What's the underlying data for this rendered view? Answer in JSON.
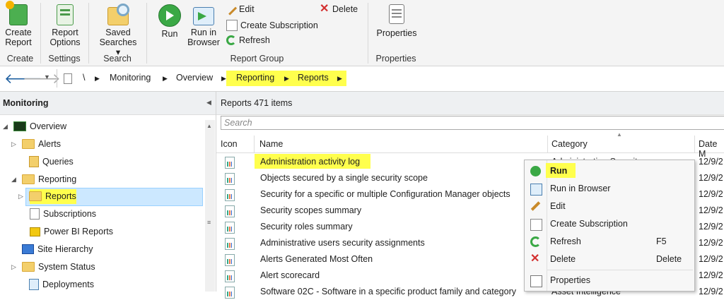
{
  "ribbon": {
    "create_report": "Create\nReport",
    "report_options": "Report\nOptions",
    "saved_searches": "Saved\nSearches ▾",
    "run": "Run",
    "run_in_browser": "Run in\nBrowser",
    "edit": "Edit",
    "create_subscription": "Create Subscription",
    "refresh": "Refresh",
    "delete": "Delete",
    "properties": "Properties",
    "groups": {
      "create": "Create",
      "settings": "Settings",
      "search": "Search",
      "report_group": "Report Group",
      "properties": "Properties"
    }
  },
  "breadcrumb": {
    "root": "\\",
    "items": [
      "Monitoring",
      "Overview",
      "Reporting",
      "Reports"
    ]
  },
  "nav": {
    "title": "Monitoring",
    "items": [
      "Overview",
      "Alerts",
      "Queries",
      "Reporting",
      "Reports",
      "Subscriptions",
      "Power BI Reports",
      "Site Hierarchy",
      "System Status",
      "Deployments"
    ]
  },
  "main": {
    "header_title": "Reports 471 items",
    "search_placeholder": "Search",
    "columns": {
      "icon": "Icon",
      "name": "Name",
      "category": "Category",
      "date": "Date M"
    },
    "rows": [
      {
        "name": "Administration activity log",
        "category": "Administration Security",
        "date": "12/9/2"
      },
      {
        "name": "Objects secured by a single security scope",
        "category": "",
        "date": "12/9/2"
      },
      {
        "name": "Security for a specific or multiple Configuration Manager objects",
        "category": "",
        "date": "12/9/2"
      },
      {
        "name": "Security scopes summary",
        "category": "",
        "date": "12/9/2"
      },
      {
        "name": "Security roles summary",
        "category": "",
        "date": "12/9/2"
      },
      {
        "name": "Administrative users security assignments",
        "category": "",
        "date": "12/9/2"
      },
      {
        "name": "Alerts Generated Most Often",
        "category": "",
        "date": "12/9/2"
      },
      {
        "name": "Alert scorecard",
        "category": "",
        "date": "12/9/2"
      },
      {
        "name": "Software 02C - Software in a specific product family and category",
        "category": "Asset Intelligence",
        "date": "12/9/2"
      }
    ]
  },
  "context_menu": {
    "run": "Run",
    "run_in_browser": "Run in Browser",
    "edit": "Edit",
    "create_subscription": "Create Subscription",
    "refresh": "Refresh",
    "refresh_key": "F5",
    "delete": "Delete",
    "delete_key": "Delete",
    "properties": "Properties"
  },
  "colors": {
    "highlight": "#ffff4d",
    "selection": "#cce8ff"
  }
}
